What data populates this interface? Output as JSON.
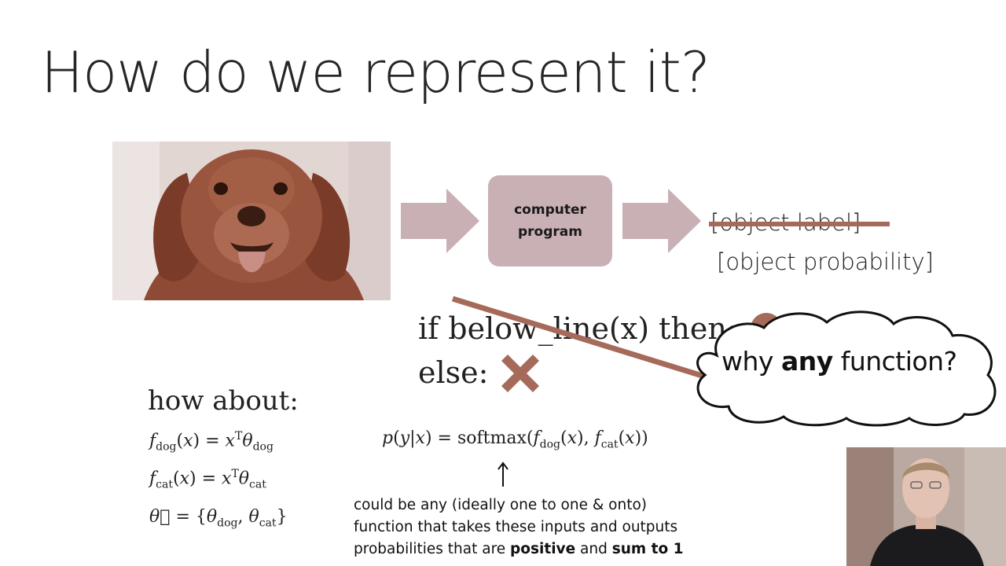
{
  "slide": {
    "title": "How do we represent it?"
  },
  "pipeline": {
    "program_line1": "computer",
    "program_line2": "program",
    "struck_label": "[object label]",
    "new_label": "[object probability]"
  },
  "rule": {
    "if_text": "if below_line(x) then:",
    "else_text": "else:"
  },
  "cloud": {
    "prefix": "why ",
    "emphasis": "any",
    "suffix": " function?"
  },
  "how_about": {
    "heading": "how about:"
  },
  "note": {
    "line1": "could be any (ideally one to one & onto)",
    "line2": "function that takes these inputs and outputs",
    "line3_a": "probabilities that are ",
    "line3_b": "positive",
    "line3_c": " and ",
    "line3_d": "sum to 1"
  },
  "colors": {
    "arrow": "#c9b0b5",
    "box": "#c9b0b5",
    "strike": "#a56a5a",
    "x_mark": "#a66a5a"
  },
  "icons": {
    "x_mark": "x-mark-icon",
    "arrow": "right-arrow-icon",
    "up_arrow": "up-arrow-icon"
  }
}
